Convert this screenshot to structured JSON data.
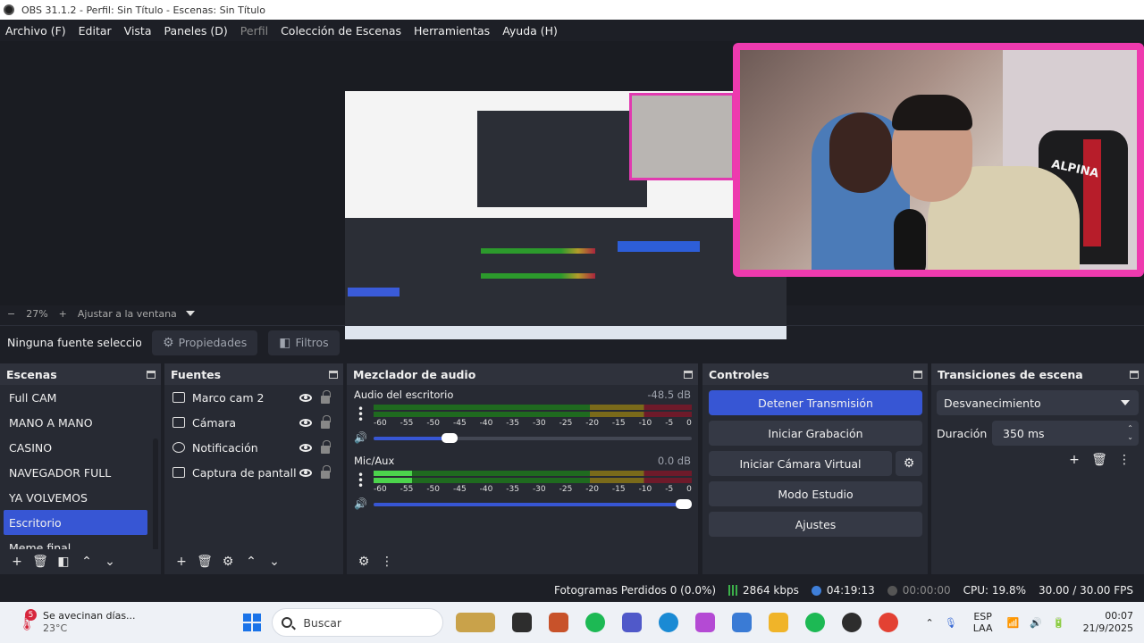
{
  "window": {
    "title": "OBS 31.1.2 - Perfil: Sin Título - Escenas: Sin Título"
  },
  "menu": [
    {
      "label": "Archivo (F)",
      "enabled": true
    },
    {
      "label": "Editar",
      "enabled": true
    },
    {
      "label": "Vista",
      "enabled": true
    },
    {
      "label": "Paneles (D)",
      "enabled": true
    },
    {
      "label": "Perfil",
      "enabled": false
    },
    {
      "label": "Colección de Escenas",
      "enabled": true
    },
    {
      "label": "Herramientas",
      "enabled": true
    },
    {
      "label": "Ayuda (H)",
      "enabled": true
    }
  ],
  "preview": {
    "webcam_text": "ALPINA"
  },
  "zoombar": {
    "minus": "−",
    "zoom": "27%",
    "plus": "+",
    "fit": "Ajustar a la ventana"
  },
  "source_toolbar": {
    "status": "Ninguna fuente seleccionada",
    "properties": "Propiedades",
    "filters": "Filtros"
  },
  "scenes": {
    "title": "Escenas",
    "items": [
      "Full CAM",
      "MANO A MANO",
      "CASINO",
      "NAVEGADOR FULL",
      "YA VOLVEMOS",
      "Escritorio",
      "Meme final"
    ],
    "active_index": 5
  },
  "sources": {
    "title": "Fuentes",
    "items": [
      {
        "label": "Marco cam 2",
        "icon": "image-icon"
      },
      {
        "label": "Cámara",
        "icon": "camera-icon"
      },
      {
        "label": "Notificación",
        "icon": "browser-icon"
      },
      {
        "label": "Captura de pantalla",
        "icon": "monitor-icon"
      }
    ]
  },
  "mixer": {
    "title": "Mezclador de audio",
    "scale": [
      "-60",
      "-55",
      "-50",
      "-45",
      "-40",
      "-35",
      "-30",
      "-25",
      "-20",
      "-15",
      "-10",
      "-5",
      "0"
    ],
    "channels": [
      {
        "name": "Audio del escritorio",
        "db": "-48.5 dB",
        "level": 0.0,
        "volume": 0.24
      },
      {
        "name": "Mic/Aux",
        "db": "0.0 dB",
        "level": 0.12,
        "volume": 1.0
      }
    ]
  },
  "controls": {
    "title": "Controles",
    "stop_stream": "Detener Transmisión",
    "start_recording": "Iniciar Grabación",
    "start_virtual_cam": "Iniciar Cámara Virtual",
    "studio_mode": "Modo Estudio",
    "settings": "Ajustes"
  },
  "transitions": {
    "title": "Transiciones de escena",
    "selected": "Desvanecimiento",
    "duration_label": "Duración",
    "duration_value": "350 ms"
  },
  "status": {
    "dropped": "Fotogramas Perdidos 0 (0.0%)",
    "bitrate": "2864 kbps",
    "stream_time": "04:19:13",
    "record_time": "00:00:00",
    "cpu": "CPU: 19.8%",
    "fps": "30.00 / 30.00 FPS"
  },
  "taskbar": {
    "weather_badge": "5",
    "weather_title": "Se avecinan días...",
    "weather_temp": "23°C",
    "search_placeholder": "Buscar",
    "lang_top": "ESP",
    "lang_bottom": "LAA",
    "time": "00:07",
    "date": "21/9/2025"
  },
  "colors": {
    "accent": "#3756d4",
    "webcam_frame": "#ee3aae"
  }
}
